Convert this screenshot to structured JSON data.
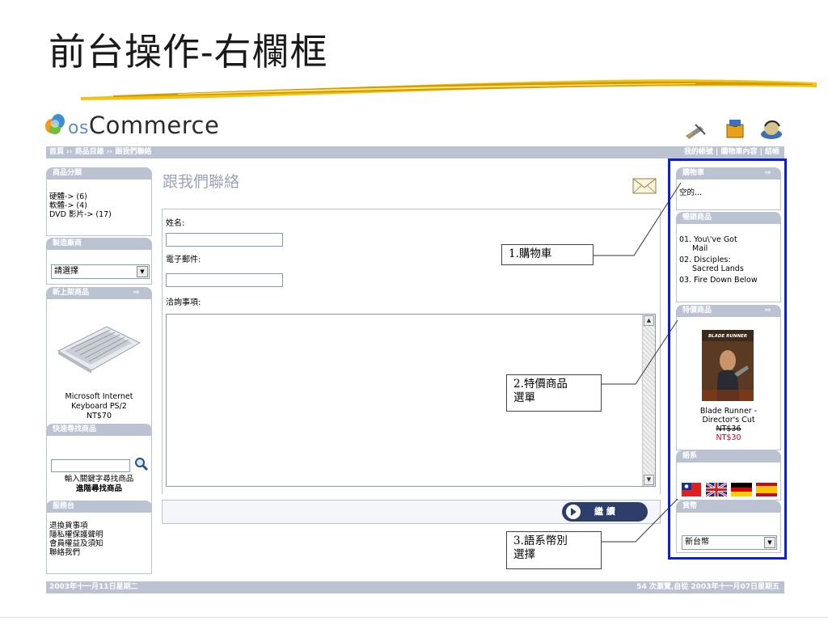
{
  "slide": {
    "title": "前台操作-右欄框"
  },
  "logo": {
    "brand_os": "os",
    "brand_main": "Commerce"
  },
  "header": {
    "breadcrumb": "首頁 ›› 商品目錄 ›› 跟我們聯絡",
    "account_links": "我的帳號 | 購物車內容 | 結帳"
  },
  "left": {
    "categories": {
      "title": "商品分類",
      "items": [
        "硬體-> (6)",
        "軟體-> (4)",
        "DVD 影片-> (17)"
      ]
    },
    "manufacturers": {
      "title": "製造廠商",
      "select_value": "請選擇"
    },
    "new_products": {
      "title": "新上架商品",
      "name_line1": "Microsoft Internet",
      "name_line2": "Keyboard PS/2",
      "price": "NT$70"
    },
    "quick_find": {
      "title": "快速尋找商品",
      "hint": "輸入關鍵字尋找商品",
      "advanced": "進階尋找商品"
    },
    "information": {
      "title": "服務台",
      "items": [
        "退換貨事項",
        "隱私權保護聲明",
        "會員權益及須知",
        "聯絡我們"
      ]
    }
  },
  "main": {
    "heading": "跟我們聯絡",
    "name_label": "姓名:",
    "email_label": "電子郵件:",
    "enquiry_label": "洽詢事項:",
    "continue_label": "繼 續"
  },
  "right": {
    "cart": {
      "title": "購物車",
      "empty": "空的..."
    },
    "bestsellers": {
      "title": "暢銷商品",
      "items": [
        {
          "num": "01.",
          "line1": "You\\'ve Got",
          "line2": "Mail"
        },
        {
          "num": "02.",
          "line1": "Disciples:",
          "line2": "Sacred Lands"
        },
        {
          "num": "03.",
          "line1": "Fire Down Below",
          "line2": ""
        }
      ]
    },
    "specials": {
      "title": "特價商品",
      "poster_text": "BLADE RUNNER",
      "name_line1": "Blade Runner -",
      "name_line2": "Director's Cut",
      "old_price": "NT$36",
      "new_price": "NT$30"
    },
    "languages": {
      "title": "語系"
    },
    "currencies": {
      "title": "貨幣",
      "select_value": "新台幣"
    }
  },
  "footer": {
    "date": "2003年十一月11日星期二",
    "counter": "54 次瀏覽,自從 2003年十一月07日星期五"
  },
  "callouts": {
    "cart": "1.購物車",
    "specials_line1": "2.特價商品",
    "specials_line2": "選單",
    "lang_line1": "3.語系幣別",
    "lang_line2": "選擇"
  },
  "colors": {
    "frame": "#0b1fd6",
    "boxhead": "#bbc3d3",
    "special_price": "#e0001b",
    "button": "#2c3e69"
  }
}
